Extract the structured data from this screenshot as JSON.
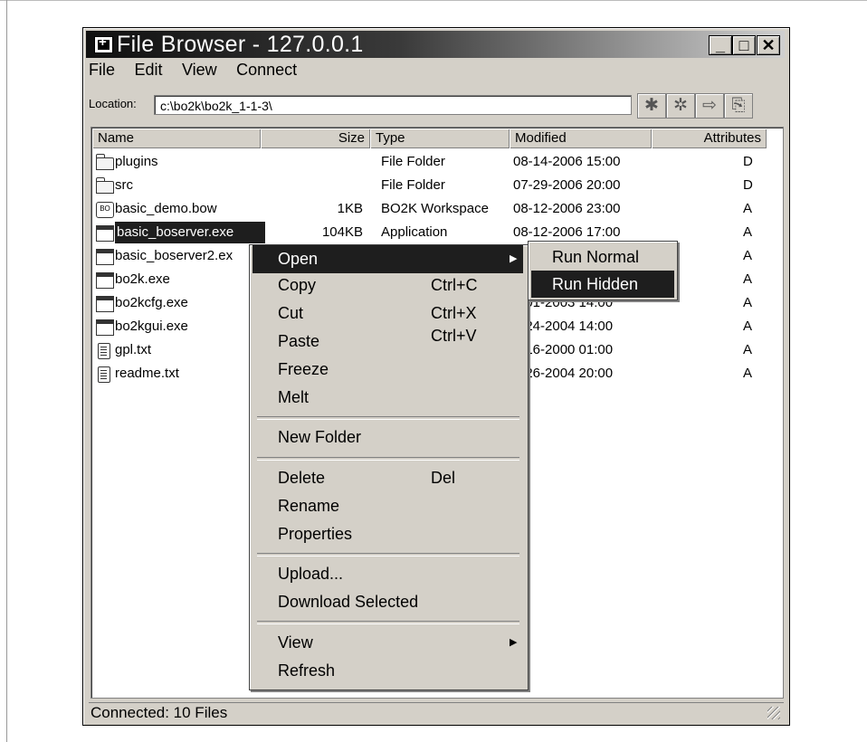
{
  "window": {
    "title": "File Browser - 127.0.0.1"
  },
  "menu": [
    "File",
    "Edit",
    "View",
    "Connect"
  ],
  "location": {
    "label": "Location:",
    "value": "c:\\bo2k\\bo2k_1-1-3\\"
  },
  "toolbar": {
    "icons": [
      "asterisk-icon",
      "asterisk-icon",
      "arrow-right-icon",
      "folder-up-icon"
    ]
  },
  "columns": [
    "Name",
    "Size",
    "Type",
    "Modified",
    "Attributes"
  ],
  "files": [
    {
      "name": "plugins",
      "size": "",
      "type": "File Folder",
      "modified": "08-14-2006 15:00",
      "attr": "D",
      "icon": "folder-icon"
    },
    {
      "name": "src",
      "size": "",
      "type": "File Folder",
      "modified": "07-29-2006 20:00",
      "attr": "D",
      "icon": "folder-icon"
    },
    {
      "name": "basic_demo.bow",
      "size": "1KB",
      "type": "BO2K Workspace",
      "modified": "08-12-2006 23:00",
      "attr": "A",
      "icon": "workspace-icon"
    },
    {
      "name": "basic_boserver.exe",
      "size": "104KB",
      "type": "Application",
      "modified": "08-12-2006 17:00",
      "attr": "A",
      "icon": "exe-icon",
      "selected": true
    },
    {
      "name": "basic_boserver2.ex",
      "size": "",
      "type": "",
      "modified": "",
      "attr": "A",
      "icon": "exe-icon"
    },
    {
      "name": "bo2k.exe",
      "size": "",
      "type": "",
      "modified": "",
      "attr": "A",
      "icon": "exe-icon"
    },
    {
      "name": "bo2kcfg.exe",
      "size": "",
      "type": "",
      "modified": "0-01-2003 14:00",
      "attr": "A",
      "icon": "exe-icon"
    },
    {
      "name": "bo2kgui.exe",
      "size": "",
      "type": "",
      "modified": "1-24-2004 14:00",
      "attr": "A",
      "icon": "exe-icon"
    },
    {
      "name": "gpl.txt",
      "size": "",
      "type": "",
      "modified": "4-16-2000 01:00",
      "attr": "A",
      "icon": "text-file-icon"
    },
    {
      "name": "readme.txt",
      "size": "",
      "type": "",
      "modified": "1-26-2004 20:00",
      "attr": "A",
      "icon": "text-file-icon"
    }
  ],
  "context_menu": {
    "open": "Open",
    "copy": "Copy",
    "copy_sc": "Ctrl+C",
    "cut": "Cut",
    "cut_sc": "Ctrl+X",
    "paste": "Paste",
    "paste_sc": "Ctrl+V",
    "freeze": "Freeze",
    "melt": "Melt",
    "new_folder": "New Folder",
    "delete": "Delete",
    "delete_sc": "Del",
    "rename": "Rename",
    "properties": "Properties",
    "upload": "Upload...",
    "download": "Download Selected",
    "view": "View",
    "refresh": "Refresh"
  },
  "submenu": {
    "run_normal": "Run Normal",
    "run_hidden": "Run Hidden"
  },
  "status": {
    "text": "Connected:  10 Files"
  }
}
